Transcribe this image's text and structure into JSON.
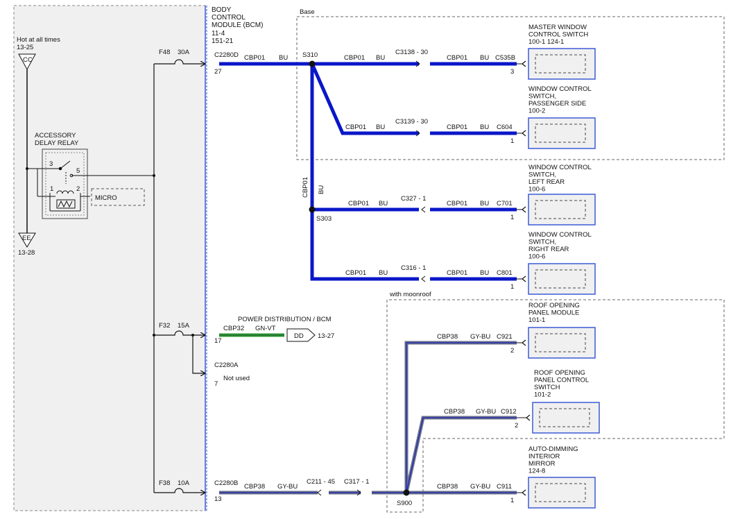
{
  "module_bcm": {
    "line1": "BODY",
    "line2": "CONTROL",
    "line3": "MODULE (BCM)",
    "ref1": "11-4",
    "ref2": "151-21"
  },
  "left_panel": {
    "hot_label": "Hot at all times",
    "hot_ref": "13-25",
    "cc": "CC",
    "relay_line1": "ACCESSORY",
    "relay_line2": "DELAY RELAY",
    "pin3": "3",
    "pin5": "5",
    "pin1": "1",
    "pin2": "2",
    "micro": "MICRO",
    "ee": "EE",
    "ee_ref": "13-28"
  },
  "fuses": {
    "f48": "F48",
    "f48_amp": "30A",
    "f32": "F32",
    "f32_amp": "15A",
    "f38": "F38",
    "f38_amp": "10A"
  },
  "bcm_pins": {
    "c2280d": "C2280D",
    "c2280d_pin": "27",
    "c2280a": "C2280A",
    "c2280a_pin": "7",
    "not_used": "Not used",
    "c2280b": "C2280B",
    "c2280b_pin": "13",
    "pdb_pin": "17"
  },
  "boxes": {
    "base": "Base",
    "moonroof": "with moonroof"
  },
  "wires": {
    "cbp01": "CBP01",
    "bu": "BU",
    "cbp32": "CBP32",
    "gnvt": "GN-VT",
    "cbp38": "CBP38",
    "gybu": "GY-BU"
  },
  "splices": {
    "s310": "S310",
    "s303": "S303",
    "s900": "S900"
  },
  "inline": {
    "c3138": "C3138 - 30",
    "c3139": "C3139 - 30",
    "c327": "C327 - 1",
    "c316": "C316 - 1",
    "c211": "C211 - 45",
    "c317": "C317 - 1"
  },
  "pdb": {
    "line": "POWER DISTRIBUTION / BCM",
    "dd": "DD",
    "ref": "13-27"
  },
  "components": [
    {
      "l1": "MASTER WINDOW",
      "l2": "CONTROL SWITCH",
      "l3": "",
      "l4": "100-1   124-1",
      "conn": "C535B",
      "pin": "3"
    },
    {
      "l1": "WINDOW CONTROL",
      "l2": "SWITCH,",
      "l3": "PASSENGER SIDE",
      "l4": "100-2",
      "conn": "C604",
      "pin": "1"
    },
    {
      "l1": "WINDOW CONTROL",
      "l2": "SWITCH,",
      "l3": "LEFT REAR",
      "l4": "100-6",
      "conn": "C701",
      "pin": "1"
    },
    {
      "l1": "WINDOW CONTROL",
      "l2": "SWITCH,",
      "l3": "RIGHT REAR",
      "l4": "100-6",
      "conn": "C801",
      "pin": "1"
    },
    {
      "l1": "ROOF OPENING",
      "l2": "PANEL MODULE",
      "l3": "",
      "l4": "101-1",
      "conn": "C921",
      "pin": "2"
    },
    {
      "l1": "ROOF OPENING",
      "l2": "PANEL CONTROL",
      "l3": "SWITCH",
      "l4": "101-2",
      "conn": "C912",
      "pin": "2"
    },
    {
      "l1": "AUTO-DIMMING",
      "l2": "INTERIOR",
      "l3": "MIRROR",
      "l4": "124-8",
      "conn": "C911",
      "pin": "1"
    }
  ],
  "colors": {
    "blue_wire": "#0a17c8",
    "green_wire": "#2f9a3a",
    "gray_wire": "#6a6f86",
    "panel_fill": "#f0f0f0",
    "module_border": "#3b5bd6"
  }
}
